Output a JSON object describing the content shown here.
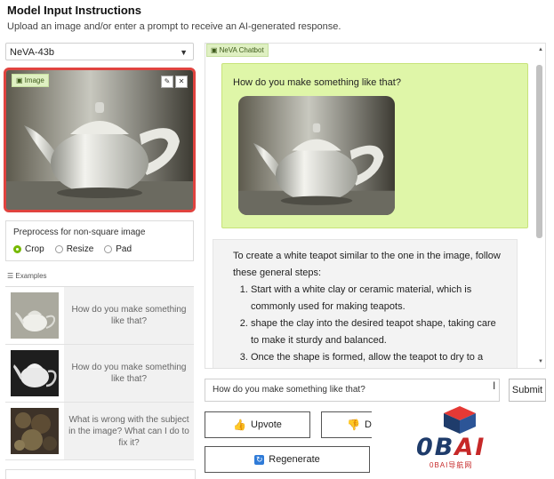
{
  "header": {
    "title": "Model Input Instructions",
    "subtitle": "Upload an image and/or enter a prompt to receive an AI-generated response."
  },
  "model_select": {
    "value": "NeVA-43b"
  },
  "image_panel": {
    "tag": "Image",
    "edit_glyph": "✎",
    "close_glyph": "✕"
  },
  "preprocess": {
    "label": "Preprocess for non-square image",
    "options": [
      "Crop",
      "Resize",
      "Pad"
    ],
    "selected": "Crop"
  },
  "examples": {
    "label": "Examples",
    "items": [
      {
        "text": "How do you make something like that?"
      },
      {
        "text": "How do you make something like that?"
      },
      {
        "text": "What is wrong with the subject in the image? What can I do to fix it?"
      }
    ]
  },
  "chatbot": {
    "tag": "NeVA Chatbot",
    "user_message": "How do you make something like that?",
    "bot_intro": "To create a white teapot similar to the one in the image, follow these general steps:",
    "bot_steps": [
      "Start with a white clay or ceramic material, which is commonly used for making teapots.",
      "shape the clay into the desired teapot shape, taking care to make it sturdy and balanced.",
      "Once the shape is formed, allow the teapot to dry to a leather-hard stage, which is the stage where it maintains"
    ]
  },
  "input": {
    "value": "How do you make something like that?"
  },
  "buttons": {
    "submit": "Submit",
    "upvote": "Upvote",
    "downvote_partial": "Do",
    "regenerate": "Regenerate"
  },
  "watermark": {
    "logo_o": "0B",
    "logo_ai": "AI",
    "sub": "0BAI导航网"
  }
}
